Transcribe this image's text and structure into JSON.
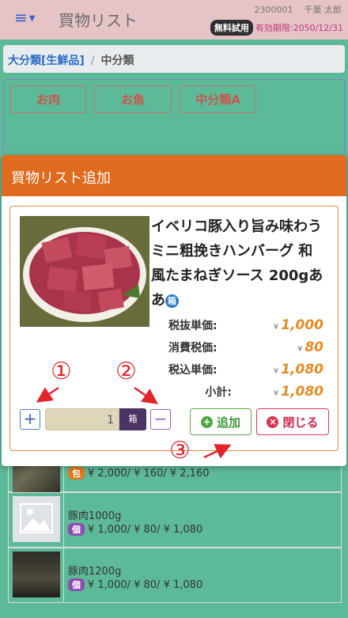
{
  "header": {
    "menu_icon": "hamburger-icon",
    "title": "買物リスト",
    "user_code": "2300001",
    "user_name": "千葉 太郎",
    "trial_badge": "無料試用",
    "expiry": "有効期限:2050/12/31"
  },
  "breadcrumb": {
    "major": "大分類[生鮮品]",
    "separator": "/",
    "current": "中分類"
  },
  "categories": [
    "お肉",
    "お魚",
    "中分類A"
  ],
  "list": [
    {
      "unit": "包",
      "price_line": "¥ 2,000/ ¥ 160/ ¥ 2,160"
    },
    {
      "name": "豚肉1000g",
      "unit": "個",
      "price_line": "¥ 1,000/ ¥ 80/ ¥ 1,080"
    },
    {
      "name": "豚肉1200g",
      "unit": "個",
      "price_line": "¥ 1,000/ ¥ 80/ ¥ 1,080"
    }
  ],
  "modal": {
    "title": "買物リスト追加",
    "product_name": "イベリコ豚入り旨み味わう ミニ粗挽きハンバーグ 和風たまねぎソース 200gああ",
    "unit_badge": "箱",
    "prices": [
      {
        "label": "税抜単価:",
        "value": "1,000"
      },
      {
        "label": "消費税価:",
        "value": "80"
      },
      {
        "label": "税込単価:",
        "value": "1,080"
      },
      {
        "label": "小計:",
        "value": "1,080"
      }
    ],
    "yen_symbol": "¥",
    "quantity": "1",
    "quantity_unit": "箱",
    "plus_label": "+",
    "minus_label": "−",
    "add_label": "追加",
    "close_label": "閉じる"
  },
  "annotations": [
    "①",
    "②",
    "③"
  ],
  "colors": {
    "header_bg": "#e6c4c6",
    "page_bg": "#5dba98",
    "modal_header": "#e06a1d",
    "price_accent": "#e98a20",
    "add_green": "#3f9b3a",
    "close_red": "#d02a4c",
    "annotation_red": "#e3242b"
  }
}
